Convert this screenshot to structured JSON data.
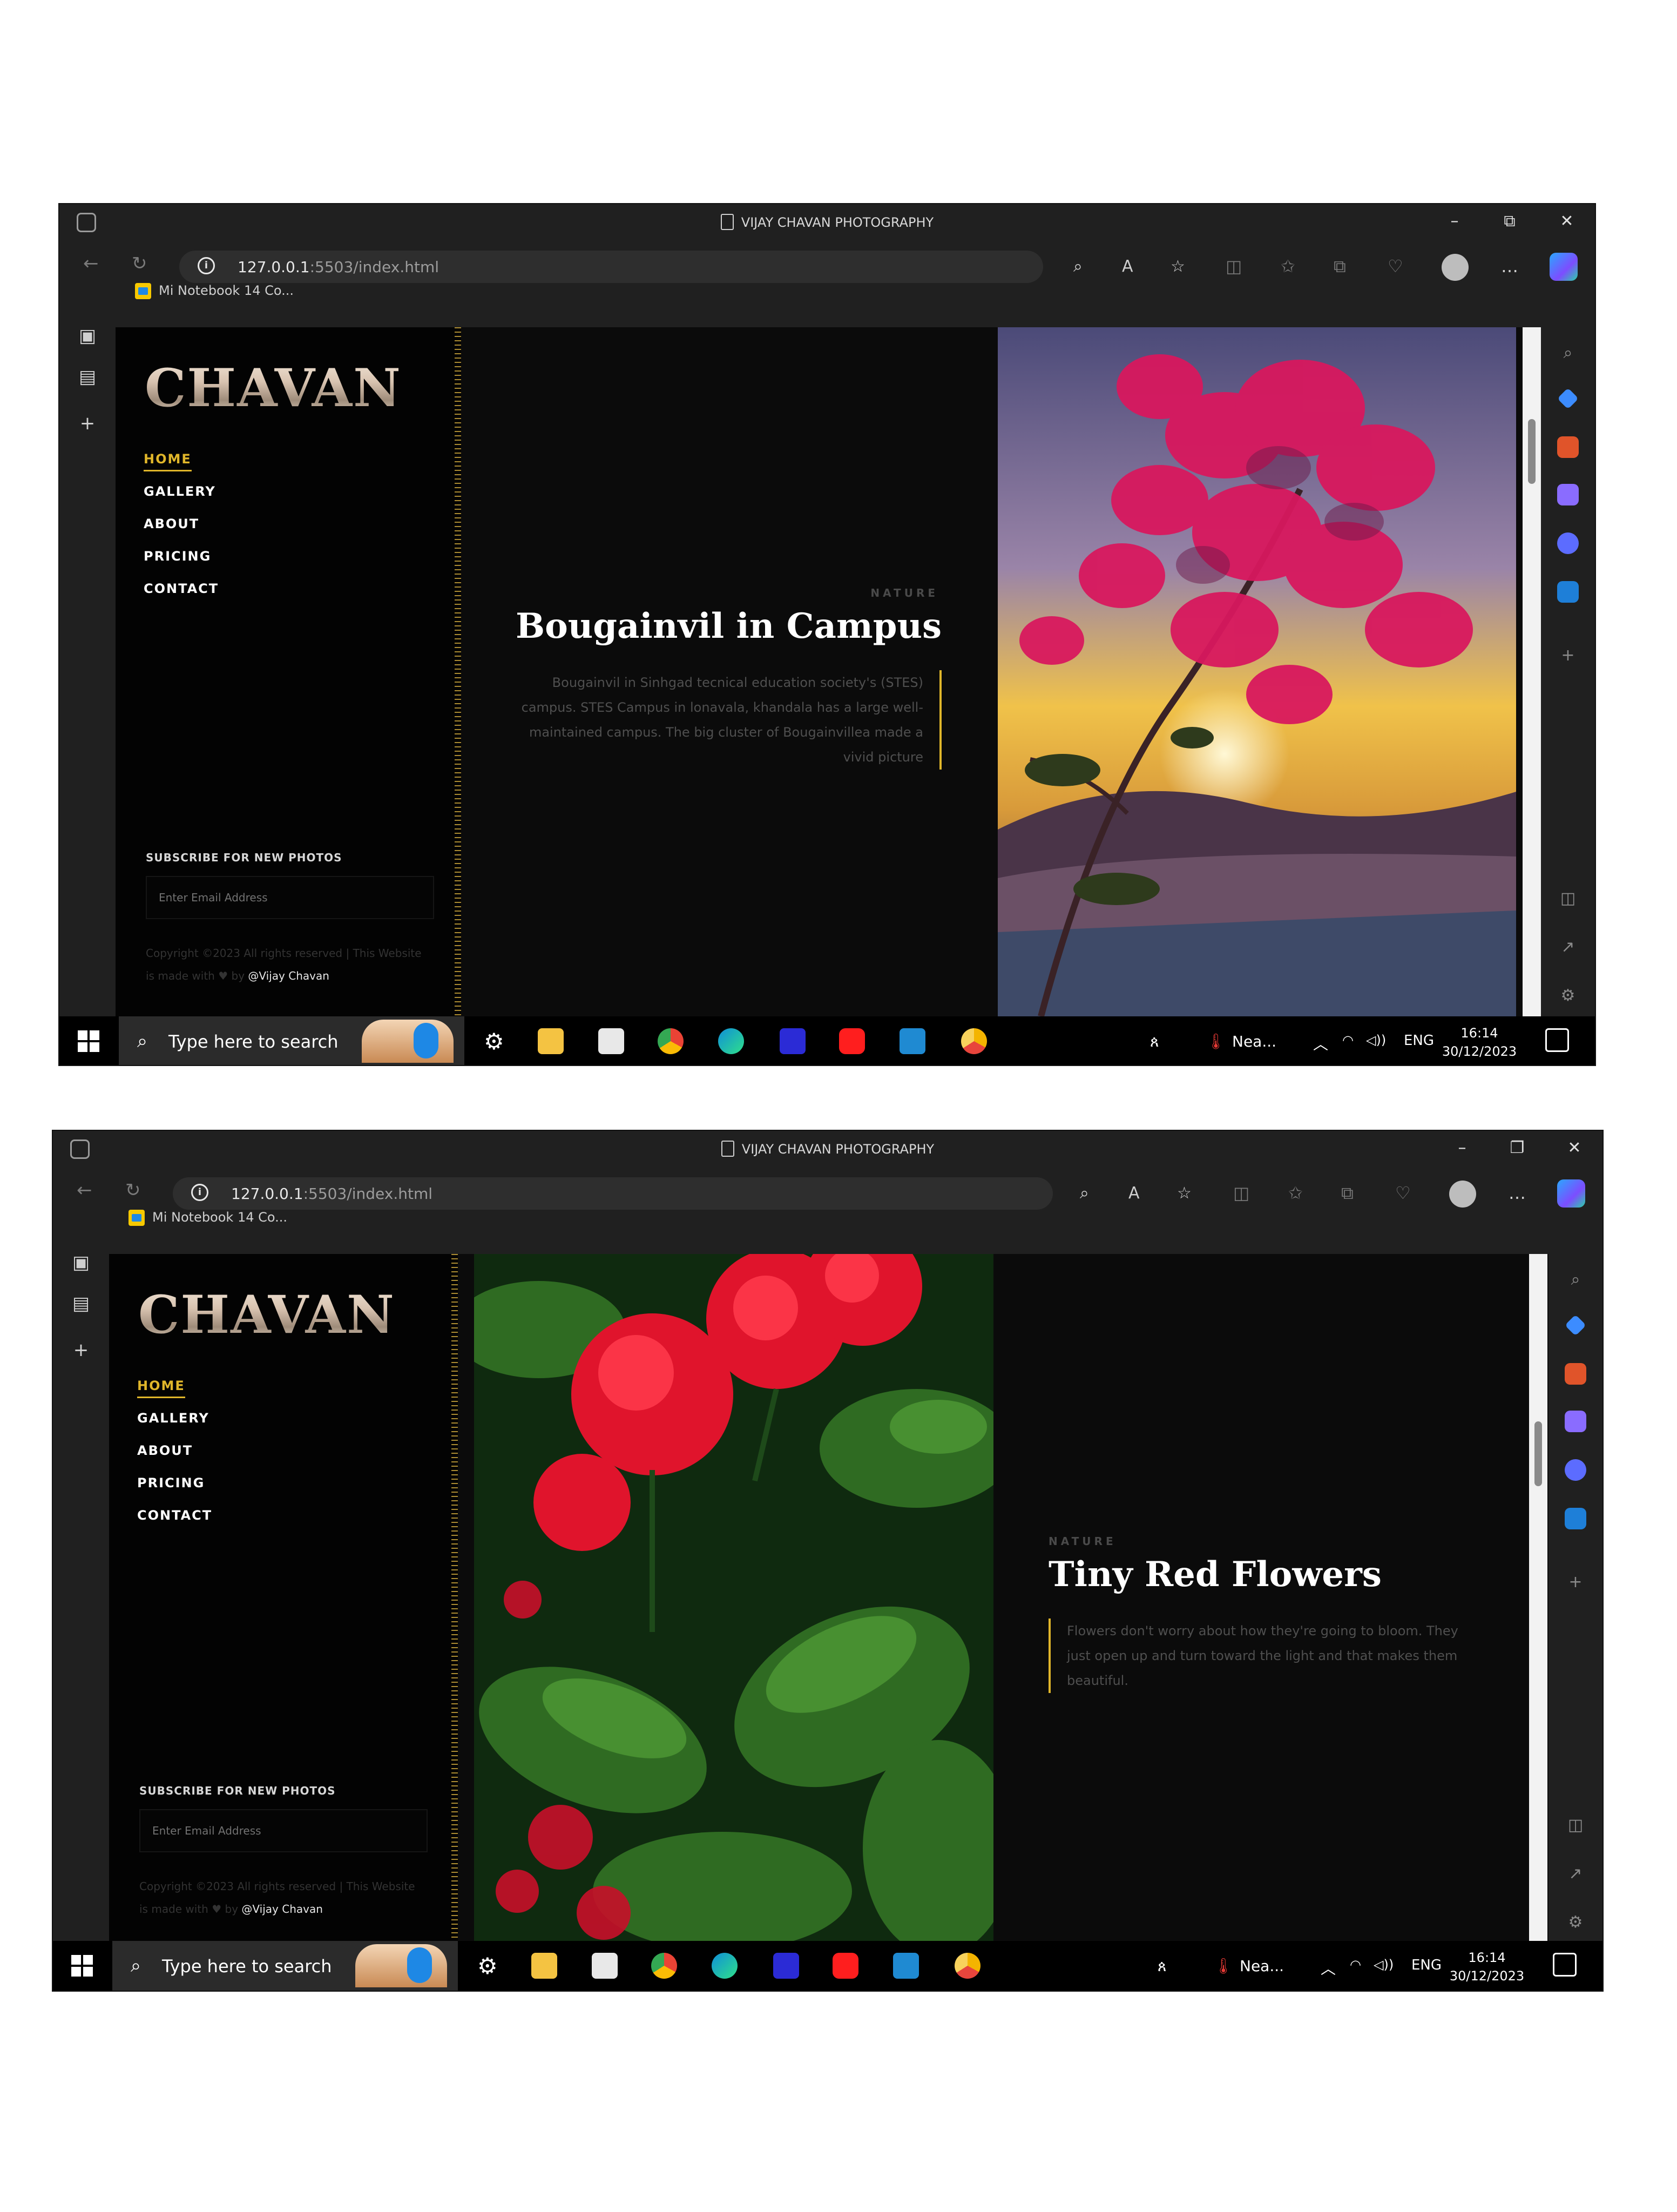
{
  "shots": [
    {
      "browser": {
        "title": "VIJAY CHAVAN PHOTOGRAPHY",
        "url_host": "127.0.0.1",
        "url_rest": ":5503/index.html",
        "favorite": "Mi Notebook 14 Co..."
      },
      "site": {
        "logo": "CHAVAN",
        "nav": [
          "HOME",
          "GALLERY",
          "ABOUT",
          "PRICING",
          "CONTACT"
        ],
        "active_nav": "HOME",
        "subscribe_label": "SUBSCRIBE FOR NEW PHOTOS",
        "email_placeholder": "Enter Email Address",
        "copyright": "Copyright ©2023 All rights reserved | This Website is made with",
        "by": "by",
        "author": "@Vijay Chavan"
      },
      "post": {
        "category": "NATURE",
        "title": "Bougainvil in Campus",
        "description": "Bougainvil in Sinhgad tecnical education society's (STES) campus. STES Campus in lonavala, khandala has a large well-maintained campus. The big cluster of Bougainvillea made a vivid picture"
      },
      "taskbar": {
        "search_text": "Type here to search",
        "weather": "Nea...",
        "lang": "ENG",
        "time": "16:14",
        "date": "30/12/2023"
      }
    },
    {
      "browser": {
        "title": "VIJAY CHAVAN PHOTOGRAPHY",
        "url_host": "127.0.0.1",
        "url_rest": ":5503/index.html",
        "favorite": "Mi Notebook 14 Co..."
      },
      "site": {
        "logo": "CHAVAN",
        "nav": [
          "HOME",
          "GALLERY",
          "ABOUT",
          "PRICING",
          "CONTACT"
        ],
        "active_nav": "HOME",
        "subscribe_label": "SUBSCRIBE FOR NEW PHOTOS",
        "email_placeholder": "Enter Email Address",
        "copyright": "Copyright ©2023 All rights reserved | This Website is made with",
        "by": "by",
        "author": "@Vijay Chavan"
      },
      "post": {
        "category": "NATURE",
        "title": "Tiny Red Flowers",
        "description": "Flowers don't worry about how they're going to bloom. They just open up and turn toward the light and that makes them beautiful."
      },
      "taskbar": {
        "search_text": "Type here to search",
        "weather": "Nea...",
        "lang": "ENG",
        "time": "16:14",
        "date": "30/12/2023"
      }
    }
  ],
  "colors": {
    "accent": "#e0b62a",
    "page_bg": "#0b0b0b",
    "sidebar_bg": "#030303",
    "browser_chrome": "#202020"
  },
  "icons": [
    "edge-tab-icon",
    "document-icon",
    "minimize-icon",
    "restore-icon",
    "close-icon",
    "back-icon",
    "refresh-icon",
    "site-info-icon",
    "zoom-icon",
    "read-aloud-icon",
    "favorite-star-icon",
    "split-screen-icon",
    "favorites-icon",
    "collections-icon",
    "extensions-icon",
    "profile-avatar",
    "more-icon",
    "copilot-icon",
    "vertical-tabs-icon",
    "history-icon",
    "new-tab-icon",
    "search-icon",
    "tag-icon",
    "toolbox-icon",
    "people-icon",
    "games-icon",
    "outlook-icon",
    "add-icon",
    "settings-icon",
    "windows-start-icon",
    "magnifier-icon",
    "heart-icon",
    "notification-icon"
  ]
}
